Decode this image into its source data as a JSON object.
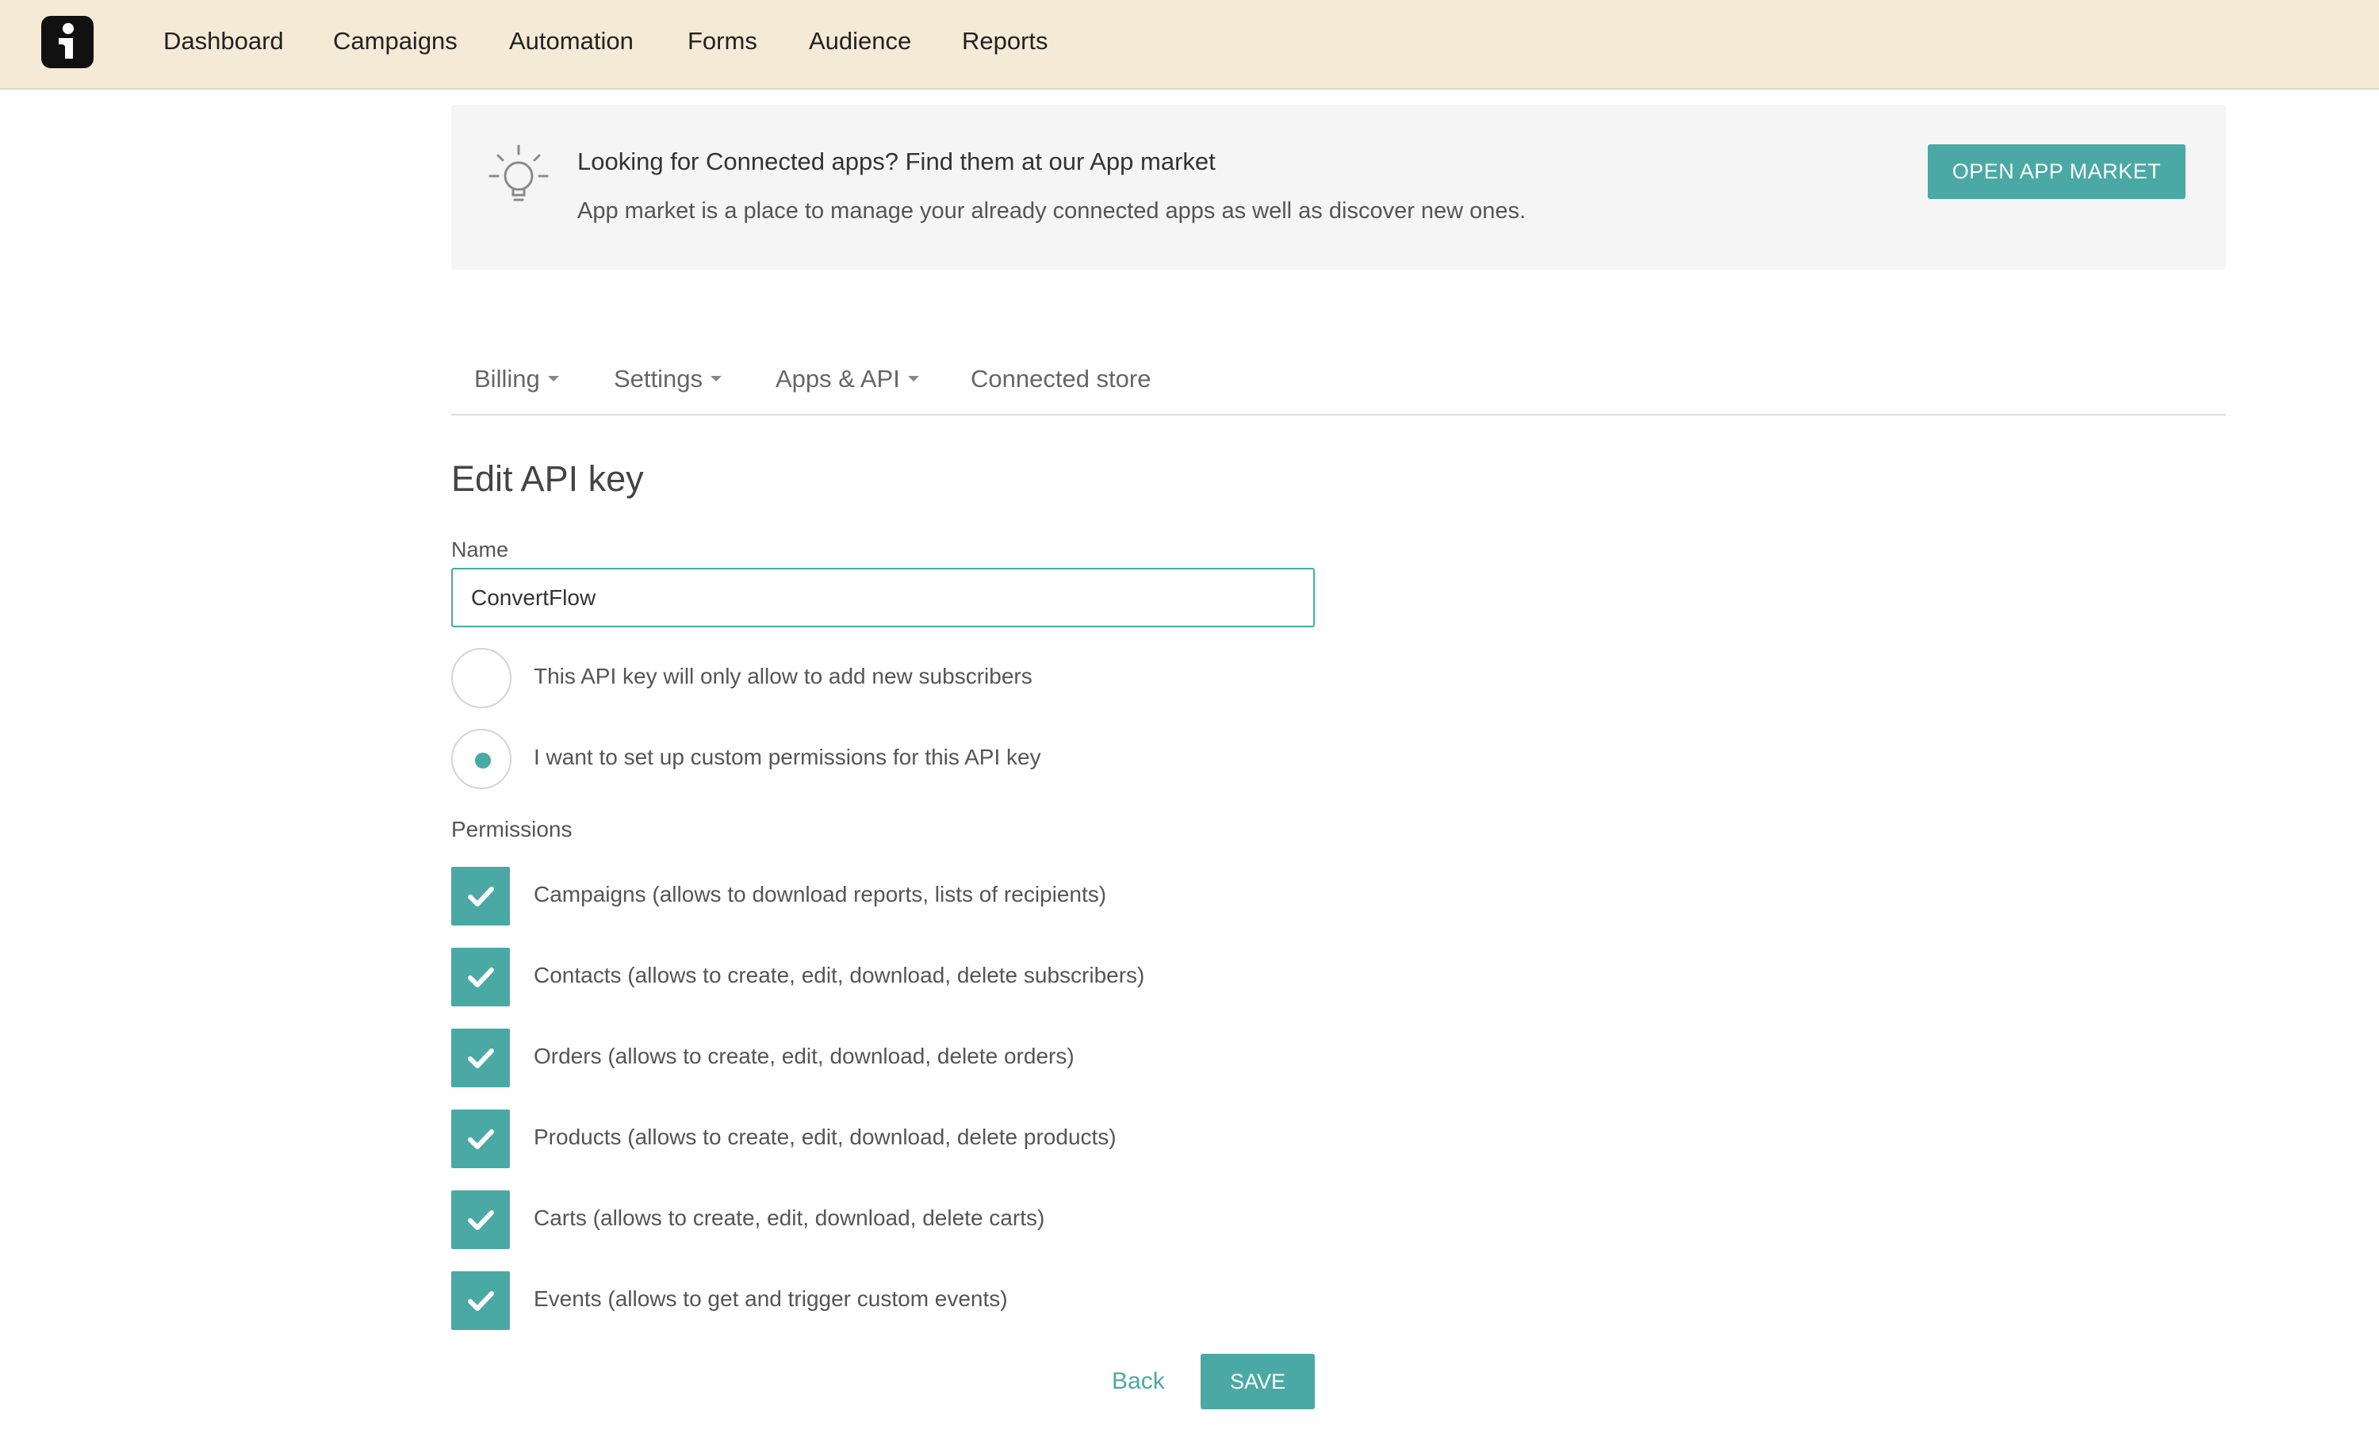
{
  "colors": {
    "accent": "#4aa9a5",
    "topbar_bg": "#f5ead6"
  },
  "topbar": {
    "logo_icon": "brand-logo-icon",
    "nav": [
      {
        "label": "Dashboard"
      },
      {
        "label": "Campaigns"
      },
      {
        "label": "Automation"
      },
      {
        "label": "Forms"
      },
      {
        "label": "Audience"
      },
      {
        "label": "Reports"
      }
    ]
  },
  "banner": {
    "icon": "lightbulb-icon",
    "title": "Looking for Connected apps? Find them at our App market",
    "description": "App market is a place to manage your already connected apps as well as discover new ones.",
    "button_label": "OPEN APP MARKET"
  },
  "subnav": {
    "items": [
      {
        "label": "Billing",
        "has_dropdown": true
      },
      {
        "label": "Settings",
        "has_dropdown": true
      },
      {
        "label": "Apps & API",
        "has_dropdown": true
      },
      {
        "label": "Connected store",
        "has_dropdown": false
      }
    ]
  },
  "form": {
    "title": "Edit API key",
    "name_label": "Name",
    "name_value": "ConvertFlow",
    "access_options": [
      {
        "label": "This API key will only allow to add new subscribers",
        "selected": false
      },
      {
        "label": "I want to set up custom permissions for this API key",
        "selected": true
      }
    ],
    "permissions_label": "Permissions",
    "permissions": [
      {
        "label": "Campaigns (allows to download reports, lists of recipients)",
        "checked": true
      },
      {
        "label": "Contacts (allows to create, edit, download, delete subscribers)",
        "checked": true
      },
      {
        "label": "Orders (allows to create, edit, download, delete orders)",
        "checked": true
      },
      {
        "label": "Products (allows to create, edit, download, delete products)",
        "checked": true
      },
      {
        "label": "Carts (allows to create, edit, download, delete carts)",
        "checked": true
      },
      {
        "label": "Events (allows to get and trigger custom events)",
        "checked": true
      }
    ],
    "back_label": "Back",
    "save_label": "SAVE"
  }
}
